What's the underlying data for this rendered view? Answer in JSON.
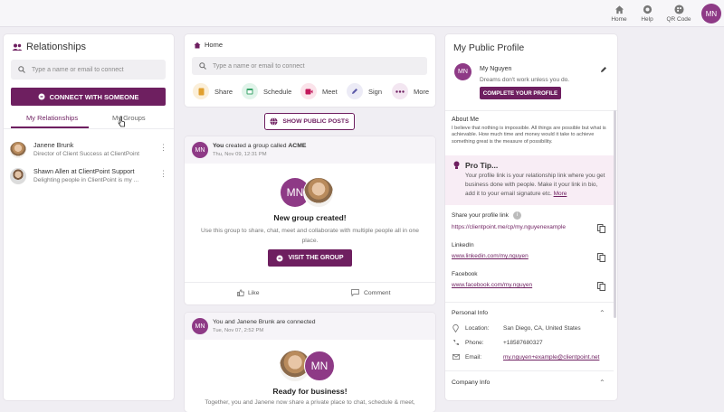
{
  "topbar": {
    "home": "Home",
    "help": "Help",
    "qr": "QR Code",
    "avatar": "MN"
  },
  "left": {
    "title": "Relationships",
    "search_placeholder": "Type a name or email to connect",
    "connect_button": "CONNECT WITH SOMEONE",
    "tabs": [
      "My Relationships",
      "My Groups"
    ],
    "contacts": [
      {
        "name": "Janene Brunk",
        "subtitle": "Director of Client Success at ClientPoint"
      },
      {
        "name": "Shawn Allen at ClientPoint Support",
        "subtitle": "Delighting people in ClientPoint is my ..."
      }
    ]
  },
  "middle": {
    "breadcrumb": "Home",
    "search_placeholder": "Type a name or email to connect",
    "actions": [
      "Share",
      "Schedule",
      "Meet",
      "Sign",
      "More"
    ],
    "show_posts_button": "SHOW PUBLIC POSTS",
    "post1": {
      "avatar": "MN",
      "actor": "You",
      "text": " created a group called ",
      "group": "ACME",
      "time": "Thu, Nov 09, 12:31 PM",
      "group_avatar": "MN",
      "heading": "New group created!",
      "body": "Use this group to share, chat, meet and collaborate with multiple people all in one place.",
      "button": "VISIT THE GROUP",
      "like": "Like",
      "comment": "Comment"
    },
    "post2": {
      "avatar": "MN",
      "text": "You and Janene Brunk are connected",
      "time": "Tue, Nov 07, 2:52 PM",
      "avatar2": "MN",
      "heading": "Ready for business!",
      "body": "Together, you and Janene now share a private place to chat, schedule & meet,"
    }
  },
  "right": {
    "title": "My Public Profile",
    "avatar": "MN",
    "name": "My Nguyen",
    "tagline": "Dreams don't work unless you do.",
    "complete_button": "COMPLETE YOUR PROFILE",
    "about_title": "About Me",
    "about_text": "I believe that nothing is impossible. All things are possible but what is achievable. How much time and money would it take to achieve something great is the measure of possibility.",
    "tip_title": "Pro Tip...",
    "tip_text": "Your profile link is your relationship link where you get business done with people. Make it your link in bio, add it to your email signature etc.",
    "tip_more": "More",
    "share_title": "Share your profile link",
    "share_link": "https://clientpoint.me/cp/my.nguyenexample",
    "linkedin_title": "LinkedIn",
    "linkedin_link": "www.linkedin.com/my.nguyen",
    "facebook_title": "Facebook",
    "facebook_link": "www.facebook.com/my.nguyen",
    "personal_title": "Personal Info",
    "location_label": "Location:",
    "location_value": "San Diego, CA, United States",
    "phone_label": "Phone:",
    "phone_value": "+18587680327",
    "email_label": "Email:",
    "email_value": "my.nguyen+example@clientpoint.net",
    "company_title": "Company Info"
  },
  "colors": {
    "accent": "#6e1f60",
    "avatar": "#8e3a86"
  }
}
